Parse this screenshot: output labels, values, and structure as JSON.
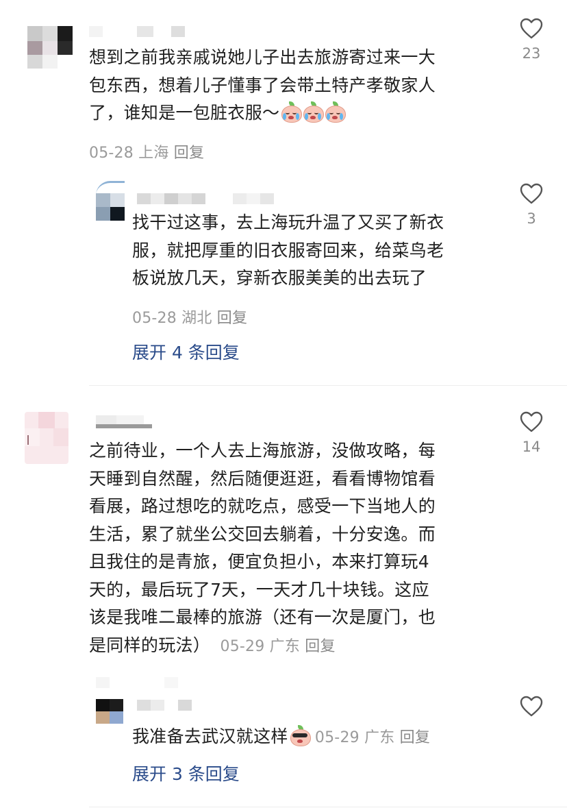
{
  "icons": {
    "like": "heart-outline-icon"
  },
  "colors": {
    "text": "#1f1f1f",
    "meta": "#9a9a9a",
    "link": "#2a4b8a",
    "divider": "#ededed"
  },
  "comments": [
    {
      "text": "想到之前我亲戚说她儿子出去旅游寄过来一大\n包东西，想着儿子懂事了会带土特产孝敬家人\n了，谁知是一包脏衣服～",
      "date": "05-28",
      "location": "上海",
      "reply_label": "回复",
      "likes": "23",
      "replies": [
        {
          "text": "找干过这事，去上海玩升温了又买了新衣\n服，就把厚重的旧衣服寄回来，给菜鸟老\n板说放几天，穿新衣服美美的出去玩了",
          "date": "05-28",
          "location": "湖北",
          "reply_label": "回复",
          "likes": "3"
        }
      ],
      "expand_label": "展开 4 条回复"
    },
    {
      "text": "之前待业，一个人去上海旅游，没做攻略，每\n天睡到自然醒，然后随便逛逛，看看博物馆看\n看展，路过想吃的就吃点，感受一下当地人的\n生活，累了就坐公交回去躺着，十分安逸。而\n且我住的是青旅，便宜负担小，本来打算玩4\n天的，最后玩了7天，一天才几十块钱。这应\n该是我唯二最棒的旅游（还有一次是厦门，也\n是同样的玩法）",
      "date": "05-29",
      "location": "广东",
      "reply_label": "回复",
      "likes": "14",
      "replies": [
        {
          "text": "我准备去武汉就这样",
          "date": "05-29",
          "location": "广东",
          "reply_label": "回复",
          "likes": ""
        }
      ],
      "expand_label": "展开 3 条回复"
    }
  ]
}
